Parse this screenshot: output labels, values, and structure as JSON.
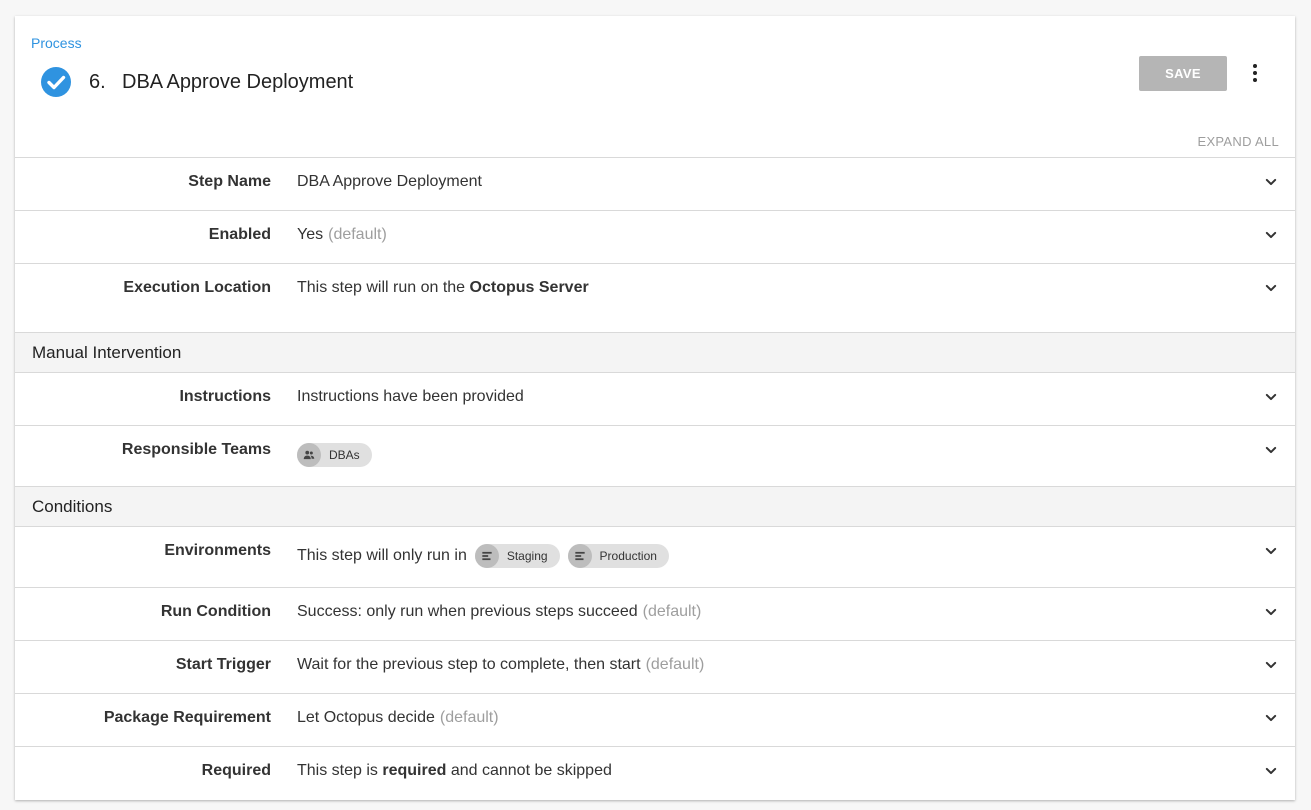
{
  "header": {
    "breadcrumb": "Process",
    "step_number": "6.",
    "step_title": "DBA Approve Deployment",
    "save_label": "SAVE",
    "expand_all_label": "EXPAND ALL"
  },
  "colors": {
    "accent": "#2f93e0",
    "save_disabled": "#b5b5b5",
    "muted_text": "#9e9e9e",
    "section_bg": "#f4f4f4"
  },
  "rows": {
    "step_name": {
      "label": "Step Name",
      "value": "DBA Approve Deployment"
    },
    "enabled": {
      "label": "Enabled",
      "value": "Yes",
      "note": "(default)"
    },
    "execution_location": {
      "label": "Execution Location",
      "value_prefix": "This step will run on the",
      "value_bold": "Octopus Server"
    },
    "instructions": {
      "label": "Instructions",
      "value": "Instructions have been provided"
    },
    "responsible_teams": {
      "label": "Responsible Teams",
      "teams": [
        "DBAs"
      ],
      "chip_icon": "people-icon"
    },
    "environments": {
      "label": "Environments",
      "value_prefix": "This step will only run in",
      "environments": [
        "Staging",
        "Production"
      ],
      "chip_icon": "environment-icon"
    },
    "run_condition": {
      "label": "Run Condition",
      "value": "Success: only run when previous steps succeed",
      "note": "(default)"
    },
    "start_trigger": {
      "label": "Start Trigger",
      "value": "Wait for the previous step to complete, then start",
      "note": "(default)"
    },
    "package_requirement": {
      "label": "Package Requirement",
      "value": "Let Octopus decide",
      "note": "(default)"
    },
    "required": {
      "label": "Required",
      "value_prefix": "This step is",
      "value_bold": "required",
      "value_suffix": "and cannot be skipped"
    }
  },
  "sections": {
    "manual_intervention": "Manual Intervention",
    "conditions": "Conditions"
  }
}
